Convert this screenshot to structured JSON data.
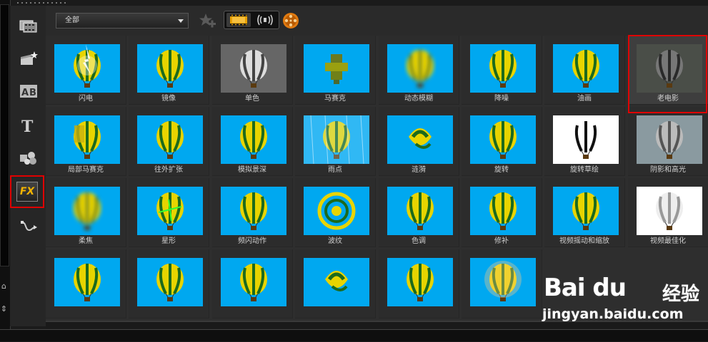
{
  "toolbar": {
    "category_value": "全部",
    "favorite_icon": "star-add-icon",
    "view_filmstrip_icon": "filmstrip-icon",
    "view_audio_icon": "audio-wave-icon",
    "reel_icon": "film-reel-icon"
  },
  "sidebar": {
    "items": [
      {
        "name": "media-library",
        "icon": "media-icon"
      },
      {
        "name": "instant-project",
        "icon": "clapper-star-icon"
      },
      {
        "name": "transition",
        "icon": "ab-transition-icon"
      },
      {
        "name": "title",
        "icon": "title-t-icon"
      },
      {
        "name": "graphic",
        "icon": "graphic-icon"
      },
      {
        "name": "filter",
        "icon": "fx-icon",
        "label": "FX"
      },
      {
        "name": "path",
        "icon": "path-icon"
      }
    ]
  },
  "filters": [
    {
      "label": "闪电",
      "style": "lightning"
    },
    {
      "label": "镜像",
      "style": "mirror"
    },
    {
      "label": "单色",
      "style": "mono"
    },
    {
      "label": "马赛克",
      "style": "mosaic"
    },
    {
      "label": "动态模糊",
      "style": "motionblur"
    },
    {
      "label": "降噪",
      "style": "normal"
    },
    {
      "label": "油画",
      "style": "oil"
    },
    {
      "label": "老电影",
      "style": "oldfilm"
    },
    {
      "label": "局部马赛克",
      "style": "localmosaic"
    },
    {
      "label": "往外扩张",
      "style": "normal"
    },
    {
      "label": "模拟景深",
      "style": "normal"
    },
    {
      "label": "雨点",
      "style": "rain"
    },
    {
      "label": "涟漪",
      "style": "ripple"
    },
    {
      "label": "旋转",
      "style": "normal"
    },
    {
      "label": "旋转草绘",
      "style": "sketch"
    },
    {
      "label": "阴影和高光",
      "style": "shadow"
    },
    {
      "label": "柔焦",
      "style": "softfocus"
    },
    {
      "label": "星形",
      "style": "star"
    },
    {
      "label": "频闪动作",
      "style": "normal"
    },
    {
      "label": "波纹",
      "style": "wave"
    },
    {
      "label": "色调",
      "style": "normal"
    },
    {
      "label": "修补",
      "style": "normal"
    },
    {
      "label": "视频摇动和缩放",
      "style": "normal"
    },
    {
      "label": "视频最佳化",
      "style": "optimize"
    },
    {
      "label": "",
      "style": "normal"
    },
    {
      "label": "",
      "style": "normal"
    },
    {
      "label": "",
      "style": "pixel"
    },
    {
      "label": "",
      "style": "swirl"
    },
    {
      "label": "",
      "style": "emboss"
    },
    {
      "label": "",
      "style": "glow"
    }
  ],
  "watermark": {
    "logo": "Bai du",
    "brand": "经验",
    "url": "jingyan.baidu.com"
  },
  "colors": {
    "highlight": "#e00000",
    "thumb_sky": "#00a8f0",
    "balloon_yellow": "#e8d400",
    "balloon_green": "#1c6a1c"
  }
}
